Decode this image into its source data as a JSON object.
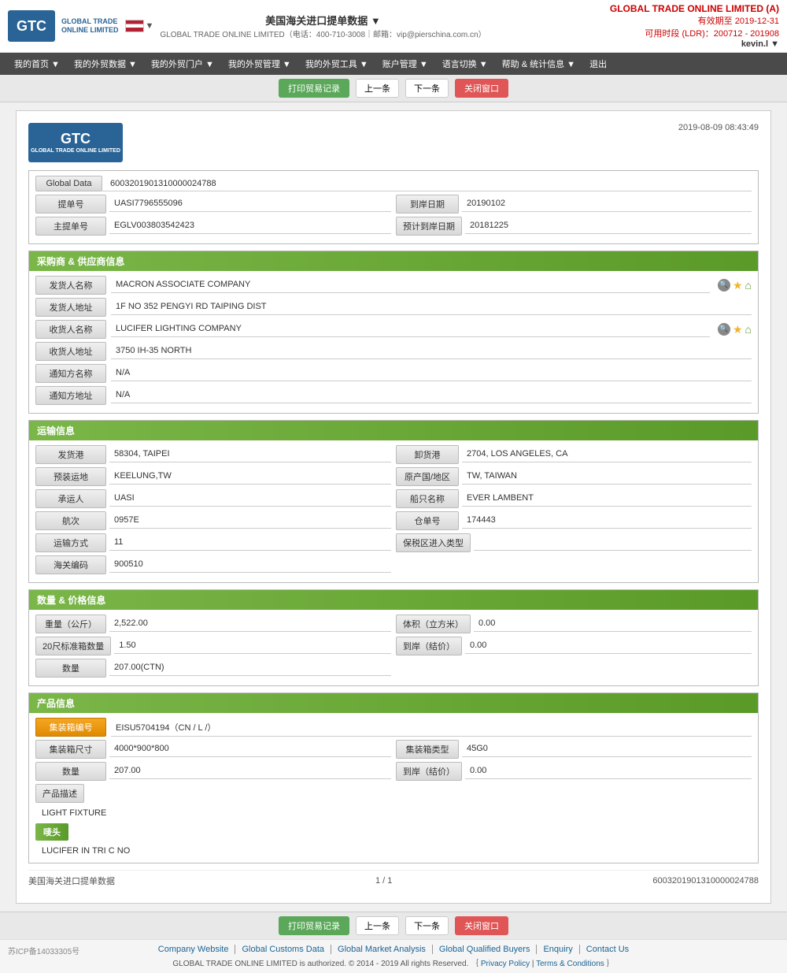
{
  "header": {
    "logo_text": "GTC\nGLOBAL TRADE ONLINE LIMITED",
    "flag_country": "USA",
    "page_title": "美国海关进口提单数据 ▼",
    "company_name": "GLOBAL TRADE ONLINE LIMITED（电话：400-710-3008｜邮箱：vip@pierschina.com.cn）",
    "brand": "GLOBAL TRADE ONLINE LIMITED (A)",
    "valid_until": "有效期至 2019-12-31",
    "available_time": "可用时段 (LDR)：200712 - 201908",
    "user": "kevin.l ▼"
  },
  "nav": {
    "items": [
      {
        "label": "我的首页 ▼"
      },
      {
        "label": "我的外贸数据 ▼"
      },
      {
        "label": "我的外贸门户 ▼"
      },
      {
        "label": "我的外贸管理 ▼"
      },
      {
        "label": "我的外贸工具 ▼"
      },
      {
        "label": "账户管理 ▼"
      },
      {
        "label": "语言切换 ▼"
      },
      {
        "label": "帮助 & 统计信息 ▼"
      },
      {
        "label": "退出"
      }
    ]
  },
  "toolbar": {
    "print_label": "打印贸易记录",
    "prev_label": "上一条",
    "next_label": "下一条",
    "close_label": "关闭窗口"
  },
  "document": {
    "datetime": "2019-08-09  08:43:49",
    "global_data_label": "Global Data",
    "global_data_value": "6003201901310000024788",
    "bill_number_label": "提单号",
    "bill_number_value": "UASI7796555096",
    "arrival_date_label": "到岸日期",
    "arrival_date_value": "20190102",
    "master_bill_label": "主提单号",
    "master_bill_value": "EGLV003803542423",
    "est_arrival_label": "预计到岸日期",
    "est_arrival_value": "20181225"
  },
  "supplier": {
    "section_title": "采购商 & 供应商信息",
    "shipper_name_label": "发货人名称",
    "shipper_name_value": "MACRON ASSOCIATE COMPANY",
    "shipper_addr_label": "发货人地址",
    "shipper_addr_value": "1F NO 352 PENGYI RD TAIPING DIST",
    "consignee_name_label": "收货人名称",
    "consignee_name_value": "LUCIFER LIGHTING COMPANY",
    "consignee_addr_label": "收货人地址",
    "consignee_addr_value": "3750 IH-35 NORTH",
    "notify_name_label": "通知方名称",
    "notify_name_value": "N/A",
    "notify_addr_label": "通知方地址",
    "notify_addr_value": "N/A"
  },
  "transport": {
    "section_title": "运输信息",
    "origin_port_label": "发货港",
    "origin_port_value": "58304, TAIPEI",
    "dest_port_label": "卸货港",
    "dest_port_value": "2704, LOS ANGELES, CA",
    "loading_label": "预装运地",
    "loading_value": "KEELUNG,TW",
    "country_label": "原产国/地区",
    "country_value": "TW, TAIWAN",
    "carrier_label": "承运人",
    "carrier_value": "UASI",
    "vessel_label": "船只名称",
    "vessel_value": "EVER LAMBENT",
    "voyage_label": "航次",
    "voyage_value": "0957E",
    "warehouse_label": "仓单号",
    "warehouse_value": "174443",
    "transport_label": "运输方式",
    "transport_value": "11",
    "bonded_label": "保税区进入类型",
    "bonded_value": "",
    "customs_label": "海关编码",
    "customs_value": "900510"
  },
  "quantity": {
    "section_title": "数量 & 价格信息",
    "weight_label": "重量（公斤）",
    "weight_value": "2,522.00",
    "volume_label": "体积（立方米）",
    "volume_value": "0.00",
    "container20_label": "20尺标准箱数量",
    "container20_value": "1.50",
    "unit_price_label": "到岸（结价）",
    "unit_price_value": "0.00",
    "qty_label": "数量",
    "qty_value": "207.00(CTN)"
  },
  "product": {
    "section_title": "产品信息",
    "container_no_label": "集装箱编号",
    "container_no_value": "EISU5704194（CN / L /）",
    "container_size_label": "集装箱尺寸",
    "container_size_value": "4000*900*800",
    "container_type_label": "集装箱类型",
    "container_type_value": "45G0",
    "qty_label": "数量",
    "qty_value": "207.00",
    "arrival_price_label": "到岸（结价）",
    "arrival_price_value": "0.00",
    "product_desc_label": "产品描述",
    "product_desc_value": "LIGHT FIXTURE",
    "marks_label": "唛头",
    "marks_value": "LUCIFER IN TRI C NO"
  },
  "pagination": {
    "source_label": "美国海关进口提单数据",
    "page_info": "1 / 1",
    "record_id": "6003201901310000024788"
  },
  "bottom_toolbar": {
    "print_label": "打印贸易记录",
    "prev_label": "上一条",
    "next_label": "下一条",
    "close_label": "关闭窗口"
  },
  "footer": {
    "links": [
      "Company Website",
      "Global Customs Data",
      "Global Market Analysis",
      "Global Qualified Buyers",
      "Enquiry",
      "Contact Us"
    ],
    "copyright": "GLOBAL TRADE ONLINE LIMITED is authorized. © 2014 - 2019 All rights Reserved.  ｛",
    "privacy": "Privacy Policy",
    "separator": "|",
    "terms": "Terms & Conditions",
    "end": "｝",
    "icp": "苏ICP备14033305号"
  }
}
